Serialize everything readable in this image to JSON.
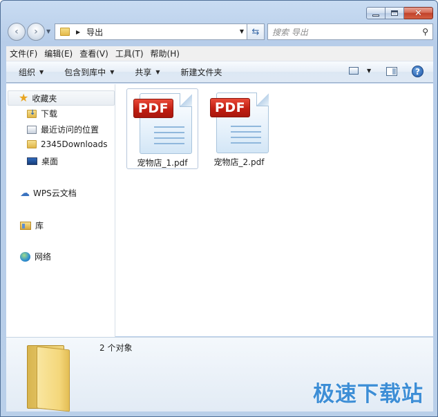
{
  "window": {
    "title_buttons": {
      "minimize": "minimize",
      "maximize": "maximize",
      "close": "✕"
    }
  },
  "address_bar": {
    "path": "导出",
    "search_placeholder": "搜索 导出"
  },
  "menu": [
    {
      "label": "文件(F)"
    },
    {
      "label": "编辑(E)"
    },
    {
      "label": "查看(V)"
    },
    {
      "label": "工具(T)"
    },
    {
      "label": "帮助(H)"
    }
  ],
  "commands": {
    "organize": "组织",
    "include_library": "包含到库中",
    "share": "共享",
    "new_folder": "新建文件夹",
    "help": "?"
  },
  "nav_pane": {
    "favorites": "收藏夹",
    "downloads": "下载",
    "recent": "最近访问的位置",
    "downloads2345": "2345Downloads",
    "desktop": "桌面",
    "wps_cloud": "WPS云文档",
    "libraries": "库",
    "network": "网络"
  },
  "files": [
    {
      "name": "宠物店_1.pdf",
      "badge": "PDF",
      "selected": true
    },
    {
      "name": "宠物店_2.pdf",
      "badge": "PDF",
      "selected": false
    }
  ],
  "details": {
    "count": "2 个对象"
  },
  "watermark": "极速下载站",
  "colors": {
    "pdf_badge": "#c21e12",
    "accent": "#3d8ed6",
    "chrome": "#c9dcf2"
  }
}
